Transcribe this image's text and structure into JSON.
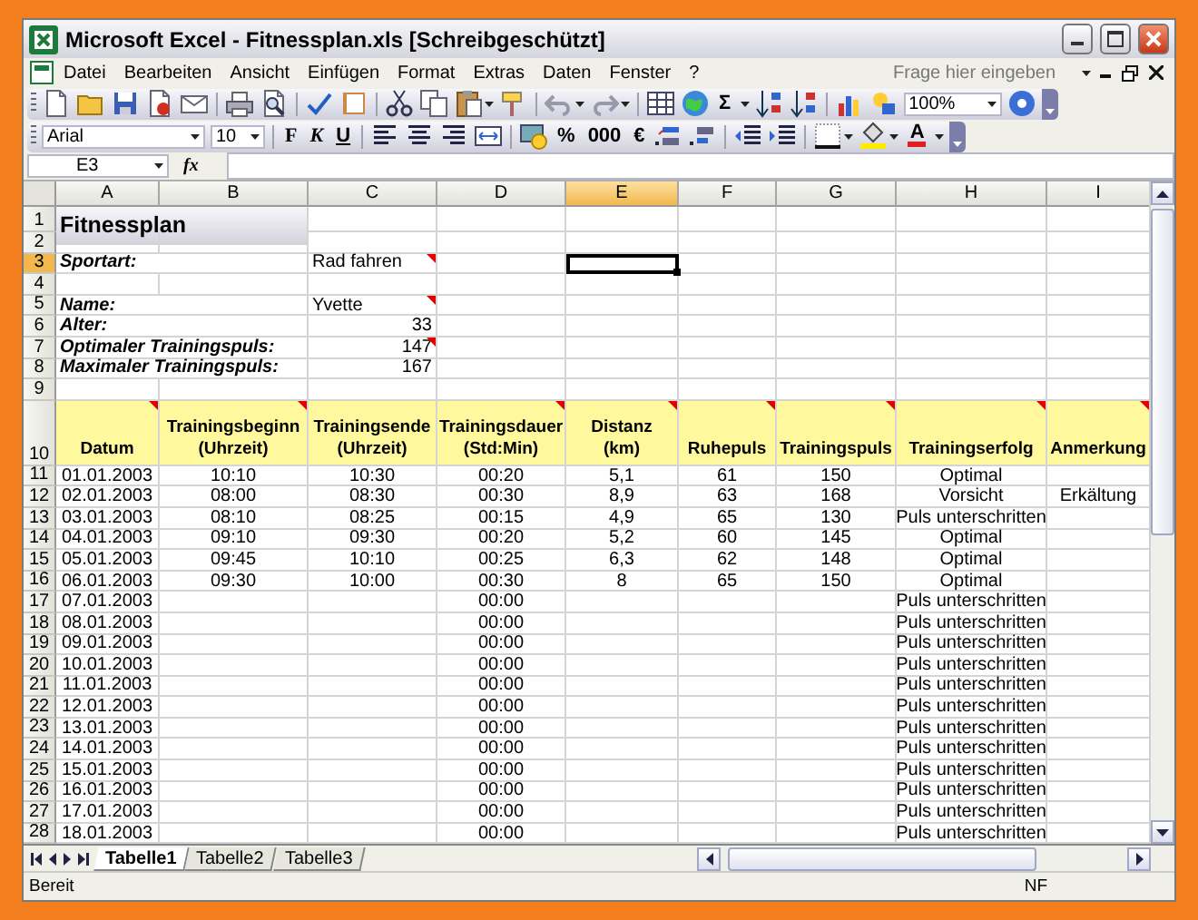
{
  "window": {
    "title": "Microsoft Excel - Fitnessplan.xls  [Schreibgeschützt]"
  },
  "menu": {
    "items": [
      "Datei",
      "Bearbeiten",
      "Ansicht",
      "Einfügen",
      "Format",
      "Extras",
      "Daten",
      "Fenster",
      "?"
    ],
    "help_placeholder": "Frage hier eingeben"
  },
  "standard_toolbar": {
    "sum": "Σ",
    "zoom": "100%"
  },
  "format_toolbar": {
    "font": "Arial",
    "size": "10",
    "style_buttons": [
      {
        "label": "F",
        "kind": "bold"
      },
      {
        "label": "K",
        "kind": "italic"
      },
      {
        "label": "U",
        "kind": "underline"
      }
    ],
    "number_buttons": [
      "%",
      "000",
      "€"
    ],
    "font_color": "A"
  },
  "formula_bar": {
    "name_box": "E3",
    "fx": "fx"
  },
  "columns": [
    {
      "label": "A",
      "selected": false
    },
    {
      "label": "B",
      "selected": false
    },
    {
      "label": "C",
      "selected": false
    },
    {
      "label": "D",
      "selected": false
    },
    {
      "label": "E",
      "selected": true
    },
    {
      "label": "F",
      "selected": false
    },
    {
      "label": "G",
      "selected": false
    },
    {
      "label": "H",
      "selected": false
    },
    {
      "label": "I",
      "selected": false
    }
  ],
  "rows": [
    {
      "number": "1",
      "kind": "title",
      "selected": false,
      "cells": [
        "Fitnessplan",
        null,
        null,
        null,
        null,
        null,
        null,
        null,
        null
      ]
    },
    {
      "number": "2",
      "kind": "blank",
      "selected": false
    },
    {
      "number": "3",
      "kind": "label_text",
      "selected": true,
      "cells": [
        "Sportart:",
        null,
        "Rad fahren",
        null,
        null,
        null,
        null,
        null,
        null
      ],
      "value_comment": true
    },
    {
      "number": "4",
      "kind": "blank",
      "selected": false
    },
    {
      "number": "5",
      "kind": "label_text",
      "selected": false,
      "cells": [
        "Name:",
        null,
        "Yvette",
        null,
        null,
        null,
        null,
        null,
        null
      ],
      "value_comment": true
    },
    {
      "number": "6",
      "kind": "label_number",
      "selected": false,
      "cells": [
        "Alter:",
        null,
        "33",
        null,
        null,
        null,
        null,
        null,
        null
      ],
      "value_comment": false
    },
    {
      "number": "7",
      "kind": "label_number",
      "selected": false,
      "cells": [
        "Optimaler Trainingspuls:",
        null,
        "147",
        null,
        null,
        null,
        null,
        null,
        null
      ],
      "value_comment": true
    },
    {
      "number": "8",
      "kind": "label_number",
      "selected": false,
      "cells": [
        "Maximaler Trainingspuls:",
        null,
        "167",
        null,
        null,
        null,
        null,
        null,
        null
      ],
      "value_comment": false
    },
    {
      "number": "9",
      "kind": "blank",
      "selected": false
    },
    {
      "number": "10",
      "kind": "header",
      "selected": false,
      "cells": [
        "Datum",
        "Trainingsbeginn\n(Uhrzeit)",
        "Trainingsende\n(Uhrzeit)",
        "Trainingsdauer\n(Std:Min)",
        "Distanz\n(km)",
        "Ruhepuls",
        "Trainingspuls",
        "Trainingserfolg",
        "Anmerkung"
      ],
      "comments": [
        true,
        true,
        false,
        true,
        true,
        true,
        true,
        true,
        true
      ]
    },
    {
      "number": "11",
      "kind": "data",
      "selected": false,
      "cells": [
        "01.01.2003",
        "10:10",
        "10:30",
        "00:20",
        "5,1",
        "61",
        "150",
        "Optimal",
        null
      ]
    },
    {
      "number": "12",
      "kind": "data",
      "selected": false,
      "cells": [
        "02.01.2003",
        "08:00",
        "08:30",
        "00:30",
        "8,9",
        "63",
        "168",
        "Vorsicht",
        "Erkältung"
      ]
    },
    {
      "number": "13",
      "kind": "data",
      "selected": false,
      "cells": [
        "03.01.2003",
        "08:10",
        "08:25",
        "00:15",
        "4,9",
        "65",
        "130",
        "Puls unterschritten",
        null
      ]
    },
    {
      "number": "14",
      "kind": "data",
      "selected": false,
      "cells": [
        "04.01.2003",
        "09:10",
        "09:30",
        "00:20",
        "5,2",
        "60",
        "145",
        "Optimal",
        null
      ]
    },
    {
      "number": "15",
      "kind": "data",
      "selected": false,
      "cells": [
        "05.01.2003",
        "09:45",
        "10:10",
        "00:25",
        "6,3",
        "62",
        "148",
        "Optimal",
        null
      ]
    },
    {
      "number": "16",
      "kind": "data",
      "selected": false,
      "cells": [
        "06.01.2003",
        "09:30",
        "10:00",
        "00:30",
        "8",
        "65",
        "150",
        "Optimal",
        null
      ]
    },
    {
      "number": "17",
      "kind": "data",
      "selected": false,
      "cells": [
        "07.01.2003",
        null,
        null,
        "00:00",
        null,
        null,
        null,
        "Puls unterschritten",
        null
      ]
    },
    {
      "number": "18",
      "kind": "data",
      "selected": false,
      "cells": [
        "08.01.2003",
        null,
        null,
        "00:00",
        null,
        null,
        null,
        "Puls unterschritten",
        null
      ]
    },
    {
      "number": "19",
      "kind": "data",
      "selected": false,
      "cells": [
        "09.01.2003",
        null,
        null,
        "00:00",
        null,
        null,
        null,
        "Puls unterschritten",
        null
      ]
    },
    {
      "number": "20",
      "kind": "data",
      "selected": false,
      "cells": [
        "10.01.2003",
        null,
        null,
        "00:00",
        null,
        null,
        null,
        "Puls unterschritten",
        null
      ]
    },
    {
      "number": "21",
      "kind": "data",
      "selected": false,
      "cells": [
        "11.01.2003",
        null,
        null,
        "00:00",
        null,
        null,
        null,
        "Puls unterschritten",
        null
      ]
    },
    {
      "number": "22",
      "kind": "data",
      "selected": false,
      "cells": [
        "12.01.2003",
        null,
        null,
        "00:00",
        null,
        null,
        null,
        "Puls unterschritten",
        null
      ]
    },
    {
      "number": "23",
      "kind": "data",
      "selected": false,
      "cells": [
        "13.01.2003",
        null,
        null,
        "00:00",
        null,
        null,
        null,
        "Puls unterschritten",
        null
      ]
    },
    {
      "number": "24",
      "kind": "data",
      "selected": false,
      "cells": [
        "14.01.2003",
        null,
        null,
        "00:00",
        null,
        null,
        null,
        "Puls unterschritten",
        null
      ]
    },
    {
      "number": "25",
      "kind": "data",
      "selected": false,
      "cells": [
        "15.01.2003",
        null,
        null,
        "00:00",
        null,
        null,
        null,
        "Puls unterschritten",
        null
      ]
    },
    {
      "number": "26",
      "kind": "data",
      "selected": false,
      "cells": [
        "16.01.2003",
        null,
        null,
        "00:00",
        null,
        null,
        null,
        "Puls unterschritten",
        null
      ]
    },
    {
      "number": "27",
      "kind": "data",
      "selected": false,
      "cells": [
        "17.01.2003",
        null,
        null,
        "00:00",
        null,
        null,
        null,
        "Puls unterschritten",
        null
      ]
    },
    {
      "number": "28",
      "kind": "data",
      "selected": false,
      "cells": [
        "18.01.2003",
        null,
        null,
        "00:00",
        null,
        null,
        null,
        "Puls unterschritten",
        null
      ]
    }
  ],
  "sheet_tabs": [
    {
      "label": "Tabelle1",
      "selected": true
    },
    {
      "label": "Tabelle2",
      "selected": false
    },
    {
      "label": "Tabelle3",
      "selected": false
    }
  ],
  "status_bar": {
    "left": "Bereit",
    "right": "NF"
  }
}
